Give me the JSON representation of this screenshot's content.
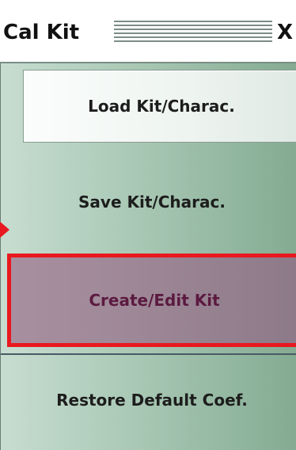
{
  "window": {
    "title": "Cal Kit",
    "close_glyph": "X"
  },
  "buttons": {
    "load_label": "Load Kit/Charac.",
    "save_label": "Save Kit/Charac.",
    "create_label": "Create/Edit Kit",
    "restore_label": "Restore Default Coef."
  },
  "highlight": {
    "target": "create-edit-kit-button",
    "color": "#e8191f"
  },
  "colors": {
    "panel_green": "#a6c6b2",
    "highlighted_button": "#9c8695",
    "highlighted_text": "#5b1a40"
  }
}
